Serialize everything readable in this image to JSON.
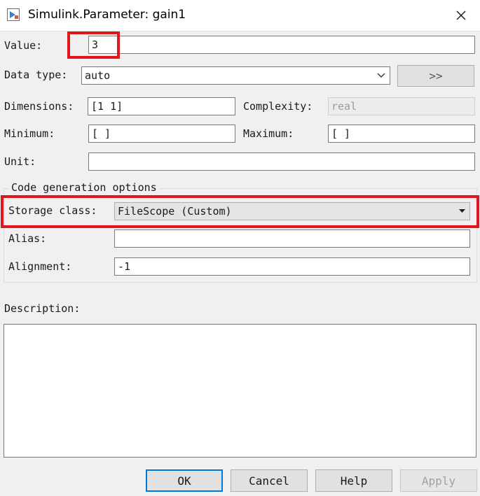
{
  "window": {
    "title": "Simulink.Parameter: gain1",
    "close_icon": "close-icon"
  },
  "fields": {
    "value_label": "Value:",
    "value": "3",
    "datatype_label": "Data type:",
    "datatype_value": "auto",
    "datatype_button": ">>",
    "dimensions_label": "Dimensions:",
    "dimensions_value": "[1 1]",
    "complexity_label": "Complexity:",
    "complexity_value": "real",
    "minimum_label": "Minimum:",
    "minimum_value": "[ ]",
    "maximum_label": "Maximum:",
    "maximum_value": "[ ]",
    "unit_label": "Unit:",
    "unit_value": ""
  },
  "codegen": {
    "group_title": "Code generation options",
    "storage_class_label": "Storage class:",
    "storage_class_value": "FileScope (Custom)",
    "alias_label": "Alias:",
    "alias_value": "",
    "alignment_label": "Alignment:",
    "alignment_value": "-1"
  },
  "description": {
    "label": "Description:",
    "value": ""
  },
  "buttons": {
    "ok": "OK",
    "cancel": "Cancel",
    "help": "Help",
    "apply": "Apply"
  },
  "highlight_color": "#e0161b"
}
